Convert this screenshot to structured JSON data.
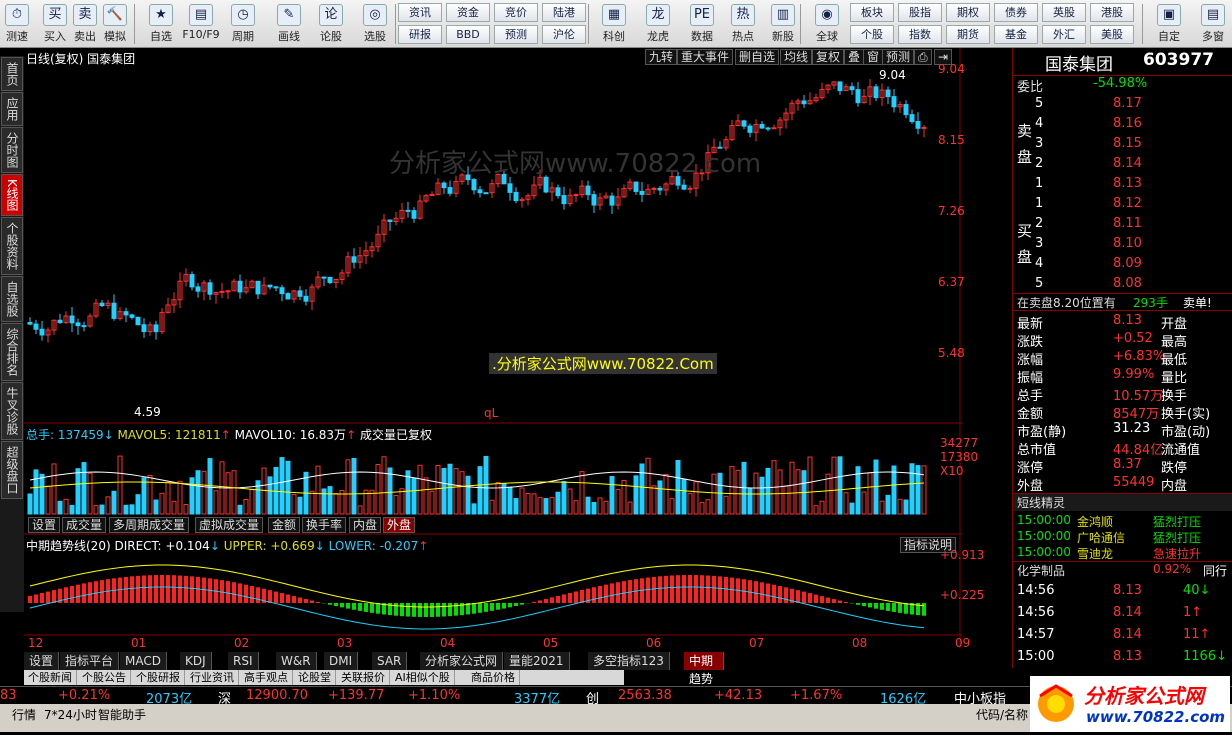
{
  "toolbar": {
    "buttons": [
      {
        "label": "测速",
        "icon": "⏱"
      },
      {
        "label": "买入",
        "icon": "买"
      },
      {
        "label": "卖出",
        "icon": "卖"
      },
      {
        "label": "模拟",
        "icon": "🔨"
      },
      {
        "label": "自选",
        "icon": "★"
      },
      {
        "label": "F10/F9",
        "icon": "▤"
      },
      {
        "label": "周期",
        "icon": "◷"
      },
      {
        "label": "画线",
        "icon": "✎"
      },
      {
        "label": "论股",
        "icon": "论"
      },
      {
        "label": "选股",
        "icon": "◎"
      },
      {
        "label": "科创",
        "icon": "▦"
      },
      {
        "label": "龙虎",
        "icon": "龙"
      },
      {
        "label": "数据",
        "icon": "PE"
      },
      {
        "label": "热点",
        "icon": "热"
      },
      {
        "label": "新股",
        "icon": "▥"
      },
      {
        "label": "全球",
        "icon": "◉"
      },
      {
        "label": "自定",
        "icon": "▣"
      },
      {
        "label": "多窗",
        "icon": "▤"
      }
    ],
    "grid1": [
      "资讯",
      "资金",
      "竞价",
      "陆港",
      "研报",
      "BBD",
      "预测",
      "沪伦"
    ],
    "grid2": [
      "板块",
      "股指",
      "期权",
      "债券",
      "英股",
      "港股",
      "个股",
      "指数",
      "期货",
      "基金",
      "外汇",
      "美股"
    ]
  },
  "lefttabs": [
    "首页",
    "应用",
    "分时图",
    "K线图",
    "个股资料",
    "自选股",
    "综合排名",
    "牛叉诊股",
    "超级盘口"
  ],
  "chart": {
    "title": "日线(复权)  国泰集团",
    "toolbar": [
      "九转",
      "重大事件",
      "删自选",
      "均线",
      "复权",
      "叠",
      "窗",
      "预测"
    ],
    "price_ticks": [
      "9.04",
      "8.15",
      "7.26",
      "6.37",
      "5.48"
    ],
    "high_mark": "9.04",
    "low_mark": "4.59",
    "marker": "qL",
    "watermark": "分析家公式网www.70822.com",
    "watermark2": ".分析家公式网www.70822.Com",
    "vol_line": {
      "a": "总手: 137459",
      "b": "MAVOL5: 121811",
      "c": "MAVOL10: 16.83万",
      "d": "成交量已复权"
    },
    "vol_ticks": [
      "34277",
      "17380",
      "X10"
    ],
    "vol_tabs": [
      "设置",
      "成交量",
      "多周期成交量",
      "虚拟成交量",
      "金额",
      "换手率",
      "内盘",
      "外盘"
    ],
    "ind_line": {
      "a": "中期趋势线(20) DIRECT: +0.104",
      "b": "UPPER: +0.669",
      "c": "LOWER: -0.207"
    },
    "ind_help": "指标说明",
    "ind_ticks": [
      "+0.913",
      "+0.225"
    ],
    "months": [
      "12",
      "01",
      "02",
      "03",
      "04",
      "05",
      "06",
      "07",
      "08",
      "09"
    ]
  },
  "right": {
    "name": "国泰集团",
    "code": "603977",
    "weibi_label": "委比",
    "weibi": "-54.98%",
    "sell_label": "卖盘",
    "buy_label": "买盘",
    "sell": [
      {
        "n": "5",
        "p": "8.17"
      },
      {
        "n": "4",
        "p": "8.16"
      },
      {
        "n": "3",
        "p": "8.15"
      },
      {
        "n": "2",
        "p": "8.14"
      },
      {
        "n": "1",
        "p": "8.13"
      }
    ],
    "buy": [
      {
        "n": "1",
        "p": "8.12"
      },
      {
        "n": "2",
        "p": "8.11"
      },
      {
        "n": "3",
        "p": "8.10"
      },
      {
        "n": "4",
        "p": "8.09"
      },
      {
        "n": "5",
        "p": "8.08"
      }
    ],
    "notice": "在卖盘8.20位置有",
    "notice_vol": "293手",
    "notice_tag": "卖单!",
    "quote": [
      {
        "l": "最新",
        "v": "8.13",
        "r": "开盘"
      },
      {
        "l": "涨跌",
        "v": "+0.52",
        "r": "最高"
      },
      {
        "l": "涨幅",
        "v": "+6.83%",
        "r": "最低"
      },
      {
        "l": "振幅",
        "v": "9.99%",
        "r": "量比"
      },
      {
        "l": "总手",
        "v": "10.57万",
        "r": "换手"
      },
      {
        "l": "金额",
        "v": "8547万",
        "r": "换手(实)"
      },
      {
        "l": "市盈(静)",
        "v": "31.23",
        "r": "市盈(动)"
      },
      {
        "l": "总市值",
        "v": "44.84亿",
        "r": "流通值"
      },
      {
        "l": "涨停",
        "v": "8.37",
        "r": "跌停"
      },
      {
        "l": "外盘",
        "v": "55449",
        "r": "内盘"
      }
    ],
    "sprite_title": "短线精灵",
    "sprites": [
      {
        "t": "15:00:00",
        "n": "金鸿顺",
        "e": "猛烈打压"
      },
      {
        "t": "15:00:00",
        "n": "广哈通信",
        "e": "猛烈打压"
      },
      {
        "t": "15:00:00",
        "n": "雪迪龙",
        "e": "急速拉升"
      }
    ],
    "sector": "化学制品",
    "sector_pct": "0.92%",
    "sector_btn": "同行",
    "ticks": [
      {
        "t": "14:56",
        "p": "8.13",
        "v": "40",
        "d": "↓"
      },
      {
        "t": "14:56",
        "p": "8.14",
        "v": "1",
        "d": "↑"
      },
      {
        "t": "14:57",
        "p": "8.14",
        "v": "11",
        "d": "↑"
      },
      {
        "t": "15:00",
        "p": "8.13",
        "v": "1166",
        "d": "↓"
      }
    ]
  },
  "bottomtabs": [
    "设置",
    "指标平台",
    "MACD",
    "KDJ",
    "RSI",
    "W&R",
    "DMI",
    "SAR",
    "分析家公式网",
    "量能2021",
    "多空指标123",
    "中期趋势线"
  ],
  "subtabs": [
    "个股新闻",
    "个股公告",
    "个股研报",
    "行业资讯",
    "高手观点",
    "论股堂",
    "关联报价",
    "AI相似个股",
    "商品价格"
  ],
  "ticker": [
    {
      "t": "83",
      "c": "red"
    },
    {
      "t": "+0.21%",
      "c": "red"
    },
    {
      "t": "2073亿",
      "c": "cyan"
    },
    {
      "t": "深",
      "c": "wht"
    },
    {
      "t": "12900.70",
      "c": "red"
    },
    {
      "t": "+139.77",
      "c": "red"
    },
    {
      "t": "+1.10%",
      "c": "red"
    },
    {
      "t": "3377亿",
      "c": "cyan"
    },
    {
      "t": "创",
      "c": "wht"
    },
    {
      "t": "2563.38",
      "c": "red"
    },
    {
      "t": "+42.13",
      "c": "red"
    },
    {
      "t": "+1.67%",
      "c": "red"
    },
    {
      "t": "1626亿",
      "c": "cyan"
    },
    {
      "t": "中小板指",
      "c": "wht"
    }
  ],
  "status": [
    "行情",
    "7*24小时",
    "智能助手",
    "代码/名称"
  ],
  "logo": {
    "text": "分析家公式网",
    "url": "www.70822.com"
  },
  "colors": {
    "up": "#ff3030",
    "down": "#20d0ff",
    "bg": "#000000",
    "panel_border": "#8a0000"
  }
}
